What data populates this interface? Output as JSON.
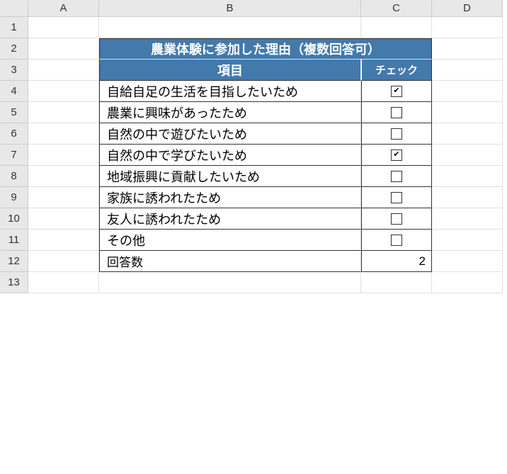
{
  "columns": [
    "A",
    "B",
    "C",
    "D"
  ],
  "rows": [
    "1",
    "2",
    "3",
    "4",
    "5",
    "6",
    "7",
    "8",
    "9",
    "10",
    "11",
    "12",
    "13"
  ],
  "title": "農業体験に参加した理由（複数回答可）",
  "header": {
    "item": "項目",
    "check": "チェック"
  },
  "items": [
    {
      "label": "自給自足の生活を目指したいため",
      "checked": true
    },
    {
      "label": "農業に興味があったため",
      "checked": false
    },
    {
      "label": "自然の中で遊びたいため",
      "checked": false
    },
    {
      "label": "自然の中で学びたいため",
      "checked": true
    },
    {
      "label": "地域振興に貢献したいため",
      "checked": false
    },
    {
      "label": "家族に誘われたため",
      "checked": false
    },
    {
      "label": "友人に誘われたため",
      "checked": false
    },
    {
      "label": "その他",
      "checked": false
    }
  ],
  "summary": {
    "label": "回答数",
    "count": 2
  }
}
